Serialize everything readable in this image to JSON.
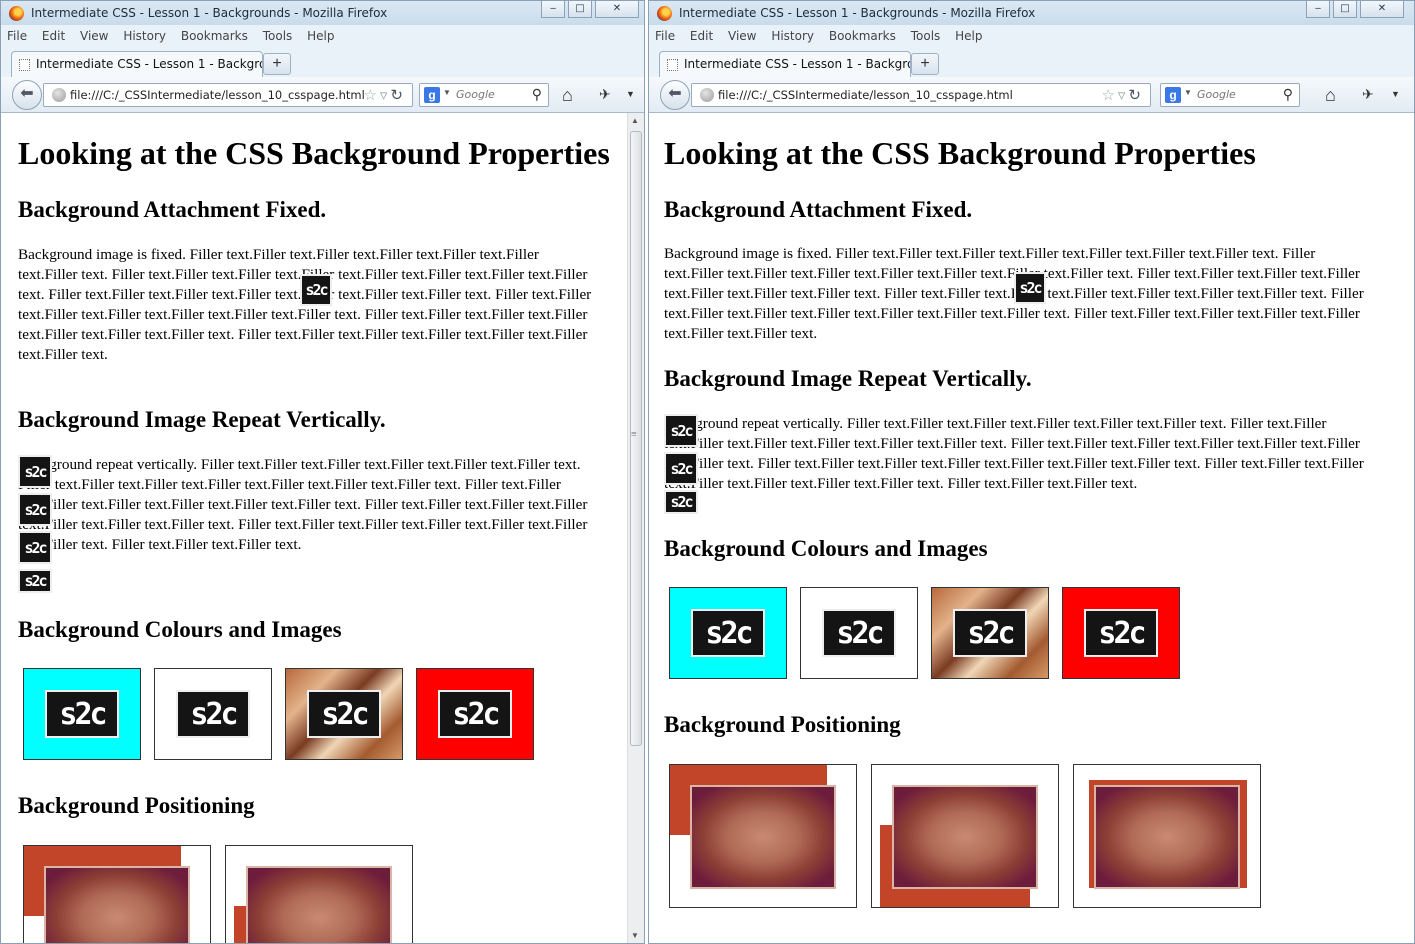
{
  "windows": [
    {
      "id": "left",
      "title": "Intermediate CSS - Lesson 1 - Backgrounds - Mozilla Firefox",
      "window_controls": {
        "min": "‒",
        "max": "□",
        "close": "✕"
      },
      "menu": [
        "File",
        "Edit",
        "View",
        "History",
        "Bookmarks",
        "Tools",
        "Help"
      ],
      "tab_title": "Intermediate CSS - Lesson 1 - Backgroun...",
      "new_tab": "+",
      "url": "file:///C:/_CSSIntermediate/lesson_10_csspage.html",
      "search_placeholder": "Google"
    },
    {
      "id": "right",
      "title": "Intermediate CSS - Lesson 1 - Backgrounds - Mozilla Firefox",
      "window_controls": {
        "min": "‒",
        "max": "□",
        "close": "✕"
      },
      "menu": [
        "File",
        "Edit",
        "View",
        "History",
        "Bookmarks",
        "Tools",
        "Help"
      ],
      "tab_title": "Intermediate CSS - Lesson 1 - Backgroun...",
      "new_tab": "+",
      "url": "file:///C:/_CSSIntermediate/lesson_10_csspage.html",
      "search_placeholder": "Google"
    }
  ],
  "page": {
    "heading": "Looking at the CSS Background Properties",
    "section_fixed": "Background Attachment Fixed.",
    "para_fixed": "Background image is fixed. Filler text.Filler text.Filler text.Filler text.Filler text.Filler text.Filler text. Filler text.Filler text.Filler text.Filler text.Filler text.Filler text.Filler text.Filler text. Filler text.Filler text.Filler text.Filler text.Filler text.Filler text.Filler text. Filler text.Filler text.Filler text.Filler text.Filler text.Filler text.Filler text. Filler text.Filler text.Filler text.Filler text.Filler text.Filler text.Filler text. Filler text.Filler text.Filler text.Filler text.Filler text.Filler text.Filler text.",
    "section_repeat": "Background Image Repeat Vertically.",
    "para_repeat": "Background repeat vertically. Filler text.Filler text.Filler text.Filler text.Filler text.Filler text. Filler text.Filler text.Filler text.Filler text.Filler text.Filler text.Filler text. Filler text.Filler text.Filler text.Filler text.Filler text.Filler text.Filler text. Filler text.Filler text.Filler text.Filler text.Filler text.Filler text.Filler text. Filler text.Filler text.Filler text.Filler text.Filler text.Filler text.Filler text. Filler text.Filler text.Filler text.",
    "section_colours": "Background Colours and Images",
    "logo_text": "s2c",
    "colour_boxes": [
      "#00ffff",
      "#ffffff",
      "food-photo",
      "#ff0000"
    ],
    "section_positioning": "Background Positioning"
  },
  "colors": {
    "chrome_bg": "#eaf2f9",
    "fixed_band": "#c2452a"
  }
}
